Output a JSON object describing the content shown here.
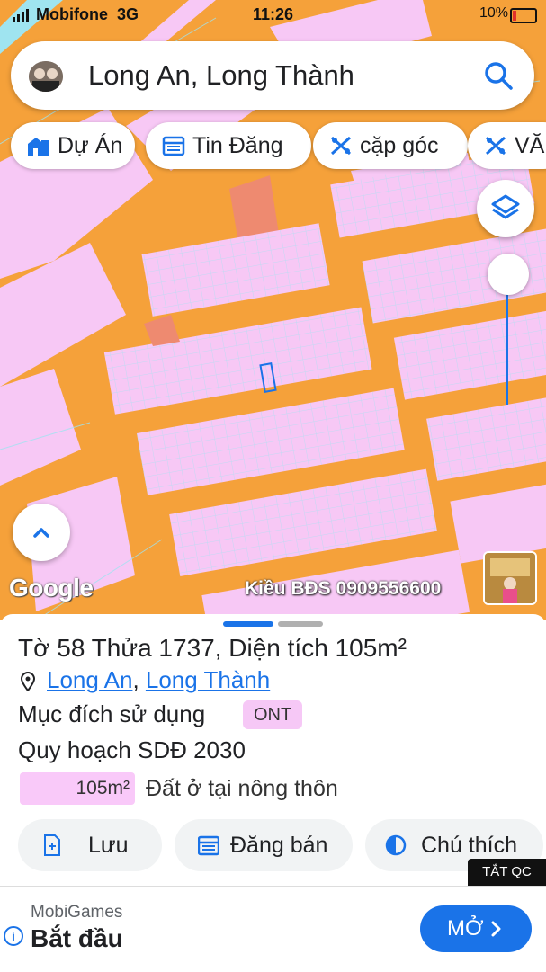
{
  "status_bar": {
    "carrier": "Mobifone",
    "network": "3G",
    "time": "11:26",
    "battery": "10%"
  },
  "search": {
    "query": "Long An, Long Thành"
  },
  "chips": [
    {
      "label": "Dự Án",
      "icon": "building-icon"
    },
    {
      "label": "Tin Đăng",
      "icon": "calendar-icon"
    },
    {
      "label": "cặp góc",
      "icon": "pattern-icon"
    },
    {
      "label": "VĂN",
      "icon": "pattern-icon"
    }
  ],
  "map": {
    "logo": "Google",
    "watermark": "Kiều BĐS 0909556600"
  },
  "parcel": {
    "title": "Tờ 58 Thửa 1737, Diện tích 105m²",
    "province": "Long An",
    "district": "Long Thành",
    "purpose_label": "Mục đích sử dụng",
    "purpose_code": "ONT",
    "plan_label": "Quy hoạch SDĐ 2030",
    "legend_area": "105m²",
    "legend_desc": "Đất ở tại nông thôn"
  },
  "actions": {
    "save": "Lưu",
    "post_sale": "Đăng bán",
    "legend": "Chú thích"
  },
  "ad": {
    "close_label": "TẮT QC",
    "brand": "MobiGames",
    "headline": "Bắt đầu",
    "button": "MỞ"
  },
  "colors": {
    "map_orange": "#f5a13a",
    "parcel_pink": "#f7c8f5",
    "accent_blue": "#1a73e8"
  }
}
